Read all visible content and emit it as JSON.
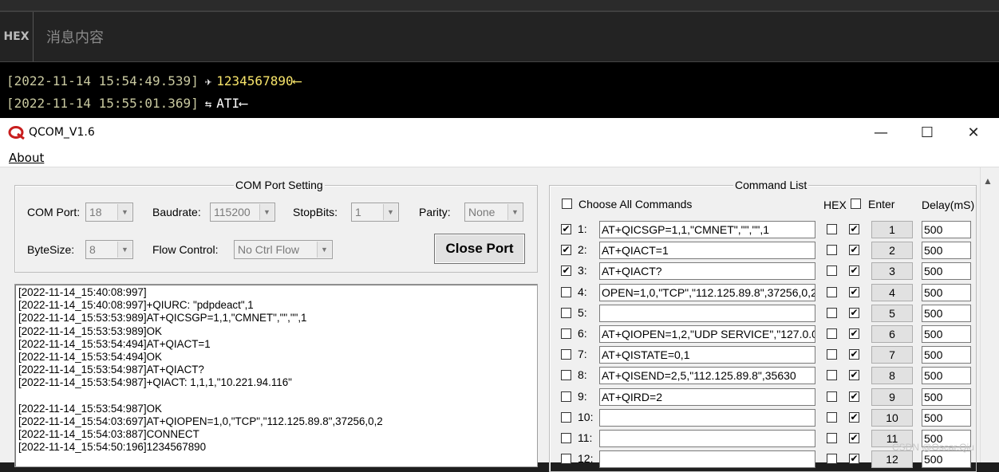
{
  "terminal": {
    "hex_label": "HEX",
    "message_placeholder": "消息内容",
    "log": [
      {
        "ts": "[2022-11-14 15:54:49.539]",
        "icon": "send-icon",
        "glyph": "✈",
        "text": "1234567890⟵",
        "color": "#f7e46a"
      },
      {
        "ts": "[2022-11-14 15:55:01.369]",
        "icon": "receive-icon",
        "glyph": "⇆",
        "text": "ATI⟵",
        "color": "#ffffff"
      }
    ]
  },
  "window": {
    "title": "QCOM_V1.6",
    "minimize": "—",
    "maximize": "☐",
    "close": "✕",
    "menu_about": "About"
  },
  "com": {
    "group_title": "COM Port Setting",
    "com_port_label": "COM Port:",
    "com_port": "18",
    "baudrate_label": "Baudrate:",
    "baudrate": "115200",
    "stopbits_label": "StopBits:",
    "stopbits": "1",
    "parity_label": "Parity:",
    "parity": "None",
    "bytesize_label": "ByteSize:",
    "bytesize": "8",
    "flow_label": "Flow Control:",
    "flow": "No Ctrl Flow",
    "close_port": "Close Port"
  },
  "receive": [
    "[2022-11-14_15:40:08:997]",
    "[2022-11-14_15:40:08:997]+QIURC: \"pdpdeact\",1",
    "[2022-11-14_15:53:53:989]AT+QICSGP=1,1,\"CMNET\",\"\",\"\",1",
    "[2022-11-14_15:53:53:989]OK",
    "[2022-11-14_15:53:54:494]AT+QIACT=1",
    "[2022-11-14_15:53:54:494]OK",
    "[2022-11-14_15:53:54:987]AT+QIACT?",
    "[2022-11-14_15:53:54:987]+QIACT: 1,1,1,\"10.221.94.116\"",
    "",
    "[2022-11-14_15:53:54:987]OK",
    "[2022-11-14_15:54:03:697]AT+QIOPEN=1,0,\"TCP\",\"112.125.89.8\",37256,0,2",
    "[2022-11-14_15:54:03:887]CONNECT",
    "[2022-11-14_15:54:50:196]1234567890"
  ],
  "commands": {
    "group_title": "Command List",
    "choose_all": "Choose All Commands",
    "hex_header": "HEX",
    "enter_header": "Enter",
    "delay_header": "Delay(mS)",
    "rows": [
      {
        "num": "1:",
        "cmd": "AT+QICSGP=1,1,\"CMNET\",\"\",\"\",1",
        "checked": "✔",
        "hex": "",
        "enter": "✔",
        "btn": "1",
        "delay": "500"
      },
      {
        "num": "2:",
        "cmd": "AT+QIACT=1",
        "checked": "✔",
        "hex": "",
        "enter": "✔",
        "btn": "2",
        "delay": "500"
      },
      {
        "num": "3:",
        "cmd": "AT+QIACT?",
        "checked": "✔",
        "hex": "",
        "enter": "✔",
        "btn": "3",
        "delay": "500"
      },
      {
        "num": "4:",
        "cmd": "OPEN=1,0,\"TCP\",\"112.125.89.8\",37256,0,2",
        "checked": "",
        "hex": "",
        "enter": "✔",
        "btn": "4",
        "delay": "500"
      },
      {
        "num": "5:",
        "cmd": "",
        "checked": "",
        "hex": "",
        "enter": "✔",
        "btn": "5",
        "delay": "500"
      },
      {
        "num": "6:",
        "cmd": "AT+QIOPEN=1,2,\"UDP SERVICE\",\"127.0.0",
        "checked": "",
        "hex": "",
        "enter": "✔",
        "btn": "6",
        "delay": "500"
      },
      {
        "num": "7:",
        "cmd": "AT+QISTATE=0,1",
        "checked": "",
        "hex": "",
        "enter": "✔",
        "btn": "7",
        "delay": "500"
      },
      {
        "num": "8:",
        "cmd": "AT+QISEND=2,5,\"112.125.89.8\",35630",
        "checked": "",
        "hex": "",
        "enter": "✔",
        "btn": "8",
        "delay": "500"
      },
      {
        "num": "9:",
        "cmd": "AT+QIRD=2",
        "checked": "",
        "hex": "",
        "enter": "✔",
        "btn": "9",
        "delay": "500"
      },
      {
        "num": "10:",
        "cmd": "",
        "checked": "",
        "hex": "",
        "enter": "✔",
        "btn": "10",
        "delay": "500"
      },
      {
        "num": "11:",
        "cmd": "",
        "checked": "",
        "hex": "",
        "enter": "✔",
        "btn": "11",
        "delay": "500"
      },
      {
        "num": "12:",
        "cmd": "",
        "checked": "",
        "hex": "",
        "enter": "✔",
        "btn": "12",
        "delay": "500"
      }
    ]
  },
  "watermark": "CSDN @Oscar.Qiu"
}
